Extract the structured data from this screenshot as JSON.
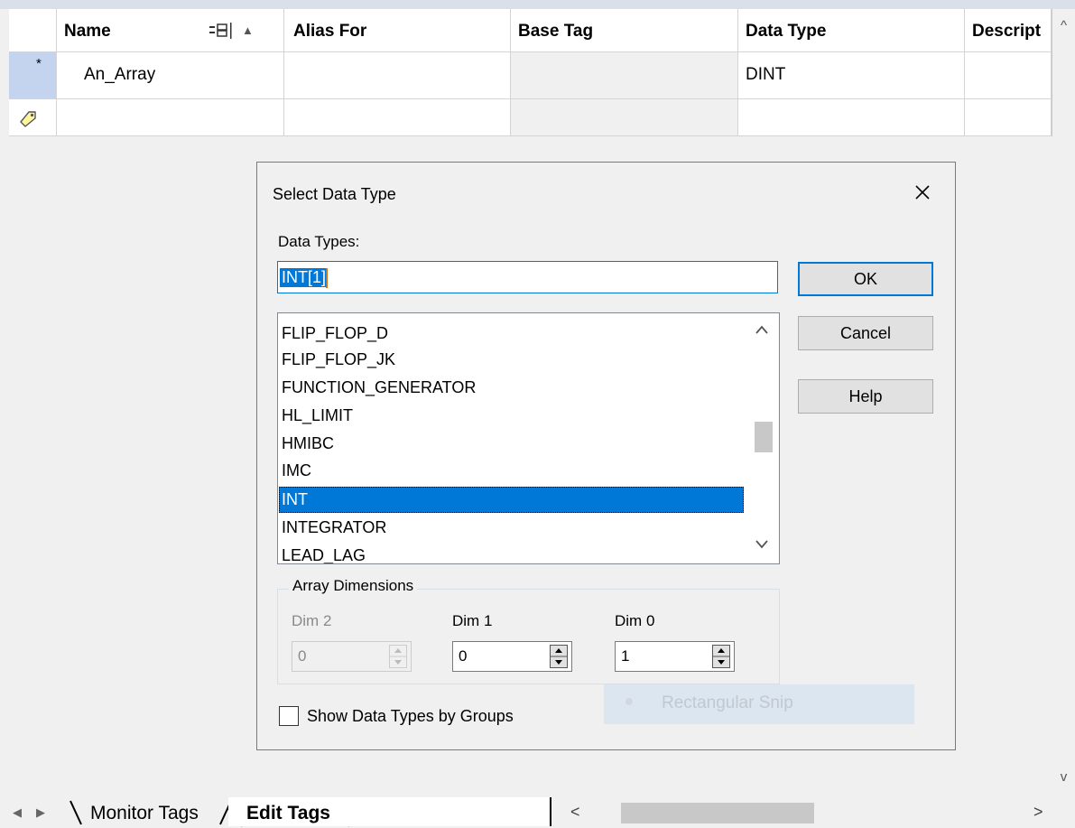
{
  "grid": {
    "columns": [
      "Name",
      "Alias For",
      "Base Tag",
      "Data Type",
      "Descript"
    ],
    "rows": [
      {
        "marker": "*",
        "name": "An_Array",
        "alias_for": "",
        "base_tag": "",
        "data_type": "DINT",
        "description": ""
      }
    ]
  },
  "dialog": {
    "title": "Select Data Type",
    "data_types_label": "Data Types:",
    "data_type_value": "INT[1]",
    "buttons": {
      "ok": "OK",
      "cancel": "Cancel",
      "help": "Help"
    },
    "type_list": [
      "FLIP_FLOP_D",
      "FLIP_FLOP_JK",
      "FUNCTION_GENERATOR",
      "HL_LIMIT",
      "HMIBC",
      "IMC",
      "INT",
      "INTEGRATOR",
      "LEAD_LAG"
    ],
    "selected_type": "INT",
    "array_dimensions": {
      "label": "Array Dimensions",
      "dims": [
        {
          "label": "Dim 2",
          "value": "0",
          "enabled": false
        },
        {
          "label": "Dim 1",
          "value": "0",
          "enabled": true
        },
        {
          "label": "Dim 0",
          "value": "1",
          "enabled": true
        }
      ]
    },
    "show_groups": {
      "label": "Show Data Types by Groups",
      "checked": false
    }
  },
  "tabs": {
    "monitor": "Monitor Tags",
    "edit": "Edit Tags",
    "active": "Edit Tags"
  },
  "snip_overlay": {
    "label": "Rectangular Snip"
  },
  "colors": {
    "selection": "#0078d7",
    "row_marker": "#c5d4ee"
  },
  "icons": [
    "tag-icon",
    "filter-icon",
    "sort-ascending-icon",
    "close-icon",
    "scroll-up-icon",
    "scroll-down-icon",
    "spin-arrows-icon"
  ]
}
